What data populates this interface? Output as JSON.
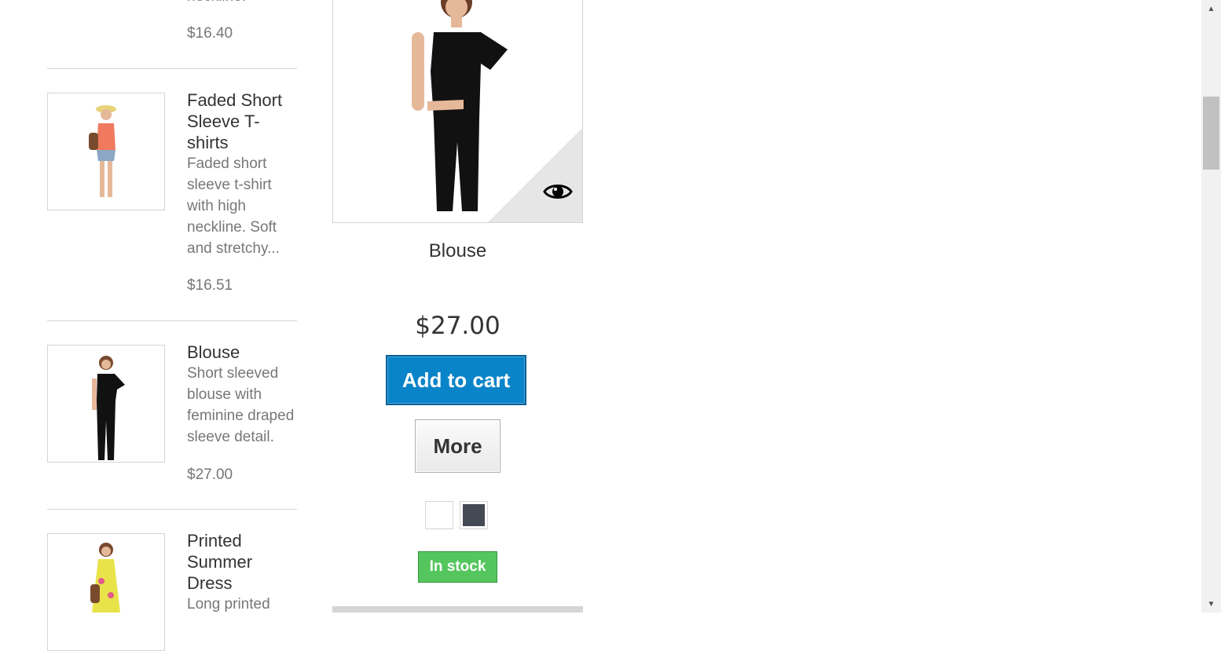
{
  "sidebar": {
    "items": [
      {
        "name": "",
        "desc_tail": "neckline.",
        "price": "$16.40"
      },
      {
        "name": "Faded Short Sleeve T-shirts",
        "desc": "Faded short sleeve t-shirt with high neckline. Soft and stretchy...",
        "price": "$16.51"
      },
      {
        "name": "Blouse",
        "desc": "Short sleeved blouse with feminine draped sleeve detail.",
        "price": "$27.00"
      },
      {
        "name": "Printed Summer Dress",
        "desc": "Long printed",
        "price": ""
      }
    ]
  },
  "product": {
    "name": "Blouse",
    "price": "$27.00",
    "add_to_cart": "Add to cart",
    "more": "More",
    "availability": "In stock",
    "colors": [
      "#ffffff",
      "#434a54"
    ]
  },
  "colors": {
    "accent": "#0a84c9",
    "stock": "#55c65e"
  }
}
